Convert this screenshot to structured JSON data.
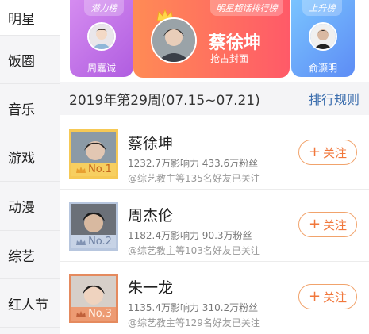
{
  "sidebar": {
    "items": [
      {
        "label": "明星",
        "active": true
      },
      {
        "label": "饭圈",
        "active": false
      },
      {
        "label": "音乐",
        "active": false
      },
      {
        "label": "游戏",
        "active": false
      },
      {
        "label": "动漫",
        "active": false
      },
      {
        "label": "综艺",
        "active": false
      },
      {
        "label": "红人节",
        "active": false
      }
    ]
  },
  "banner": {
    "left": {
      "tag": "潜力榜",
      "name": "周嘉诚"
    },
    "center": {
      "tag": "明星超话排行榜",
      "name": "蔡徐坤",
      "subtitle": "抢占封面"
    },
    "right": {
      "tag": "上升榜",
      "name": "俞灏明"
    }
  },
  "week": {
    "title": "2019年第29周(07.15~07.21)",
    "rule_link": "排行规则"
  },
  "ranking": [
    {
      "rank_label": "No.1",
      "name": "蔡徐坤",
      "stats": "1232.7万影响力 433.6万粉丝",
      "friends": "@综艺教主等135名好友已关注",
      "follow_label": "关注"
    },
    {
      "rank_label": "No.2",
      "name": "周杰伦",
      "stats": "1182.4万影响力 90.3万粉丝",
      "friends": "@综艺教主等103名好友已关注",
      "follow_label": "关注"
    },
    {
      "rank_label": "No.3",
      "name": "朱一龙",
      "stats": "1135.4万影响力 310.2万粉丝",
      "friends": "@综艺教主等129名好友已关注",
      "follow_label": "关注"
    }
  ],
  "colors": {
    "accent_orange": "#f1773b",
    "link_blue": "#3d6fae",
    "rank1": "#f6c955",
    "rank2": "#b7c6de",
    "rank3": "#e58a5e"
  }
}
